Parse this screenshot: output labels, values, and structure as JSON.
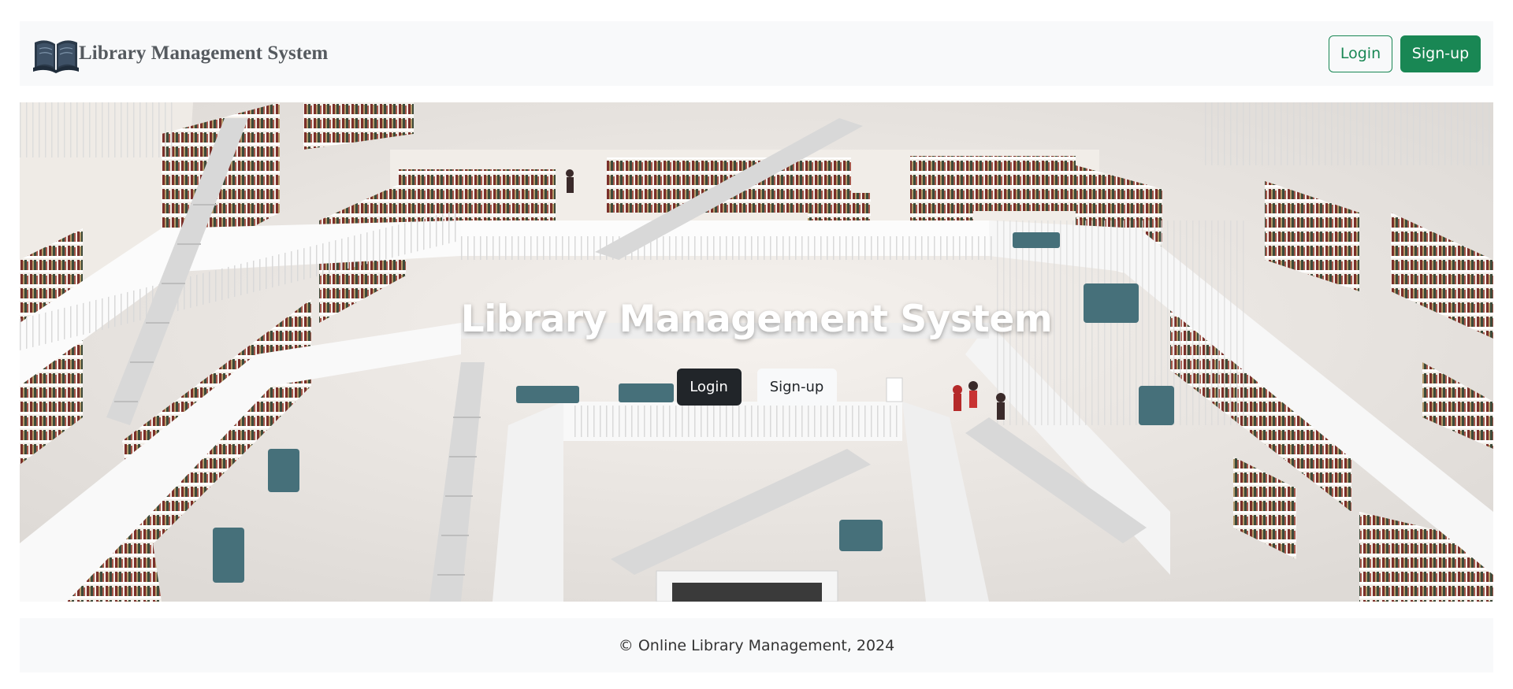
{
  "navbar": {
    "brand_logo_icon": "open-book-icon",
    "brand_title": "Library Management System",
    "login_label": "Login",
    "signup_label": "Sign-up",
    "colors": {
      "background": "#f8f9fa",
      "success": "#198754",
      "brand_text": "#555a5f"
    }
  },
  "hero": {
    "background_image": "library-interior-image",
    "title": "Library Management System",
    "login_label": "Login",
    "signup_label": "Sign-up",
    "colors": {
      "dark_button": "#212529",
      "light_button": "#f8f9fa"
    }
  },
  "footer": {
    "text": "© Online Library Management, 2024"
  }
}
